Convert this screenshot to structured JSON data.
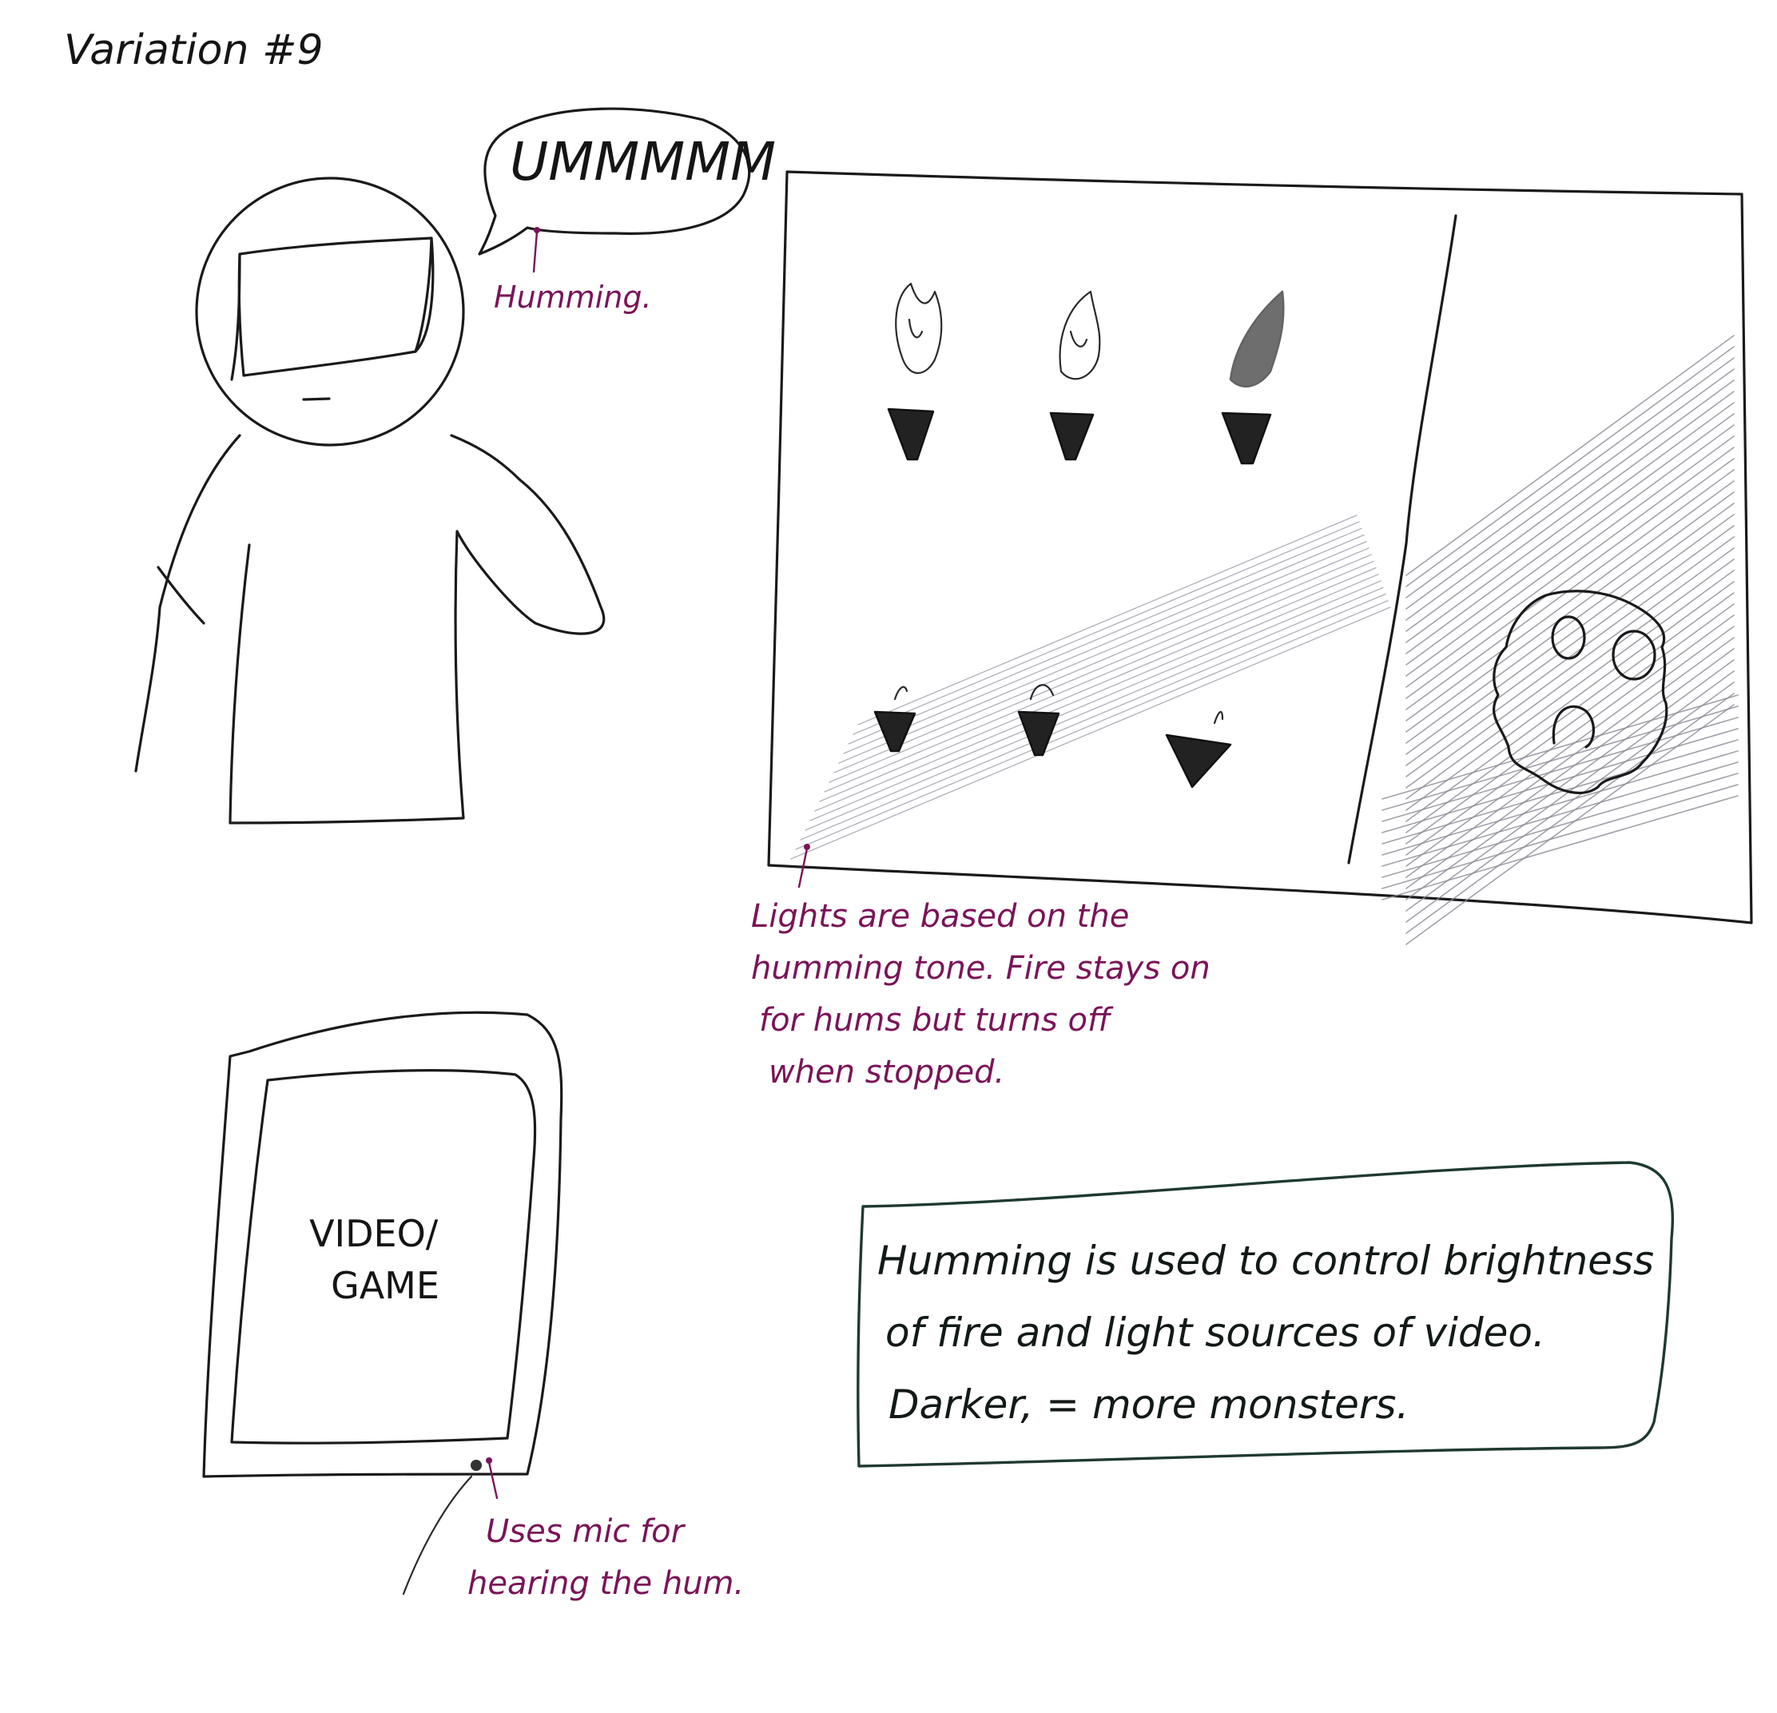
{
  "title": "Variation #9",
  "speech_bubble": "UMMMMM",
  "humming_note": "Humming.",
  "lights_note": [
    "Lights are based on the",
    "humming tone. Fire stays on",
    "for hums but turns off",
    "when stopped."
  ],
  "device_label": [
    "VIDEO/",
    "GAME"
  ],
  "mic_note": [
    "Uses mic for",
    "hearing the hum."
  ],
  "summary": [
    "Humming is used to control brightness",
    "of fire and light sources of video.",
    "Darker, = more monsters."
  ],
  "colors": {
    "ink": "#151515",
    "annotation": "#7a1458",
    "box_border": "#1f3a2e"
  }
}
